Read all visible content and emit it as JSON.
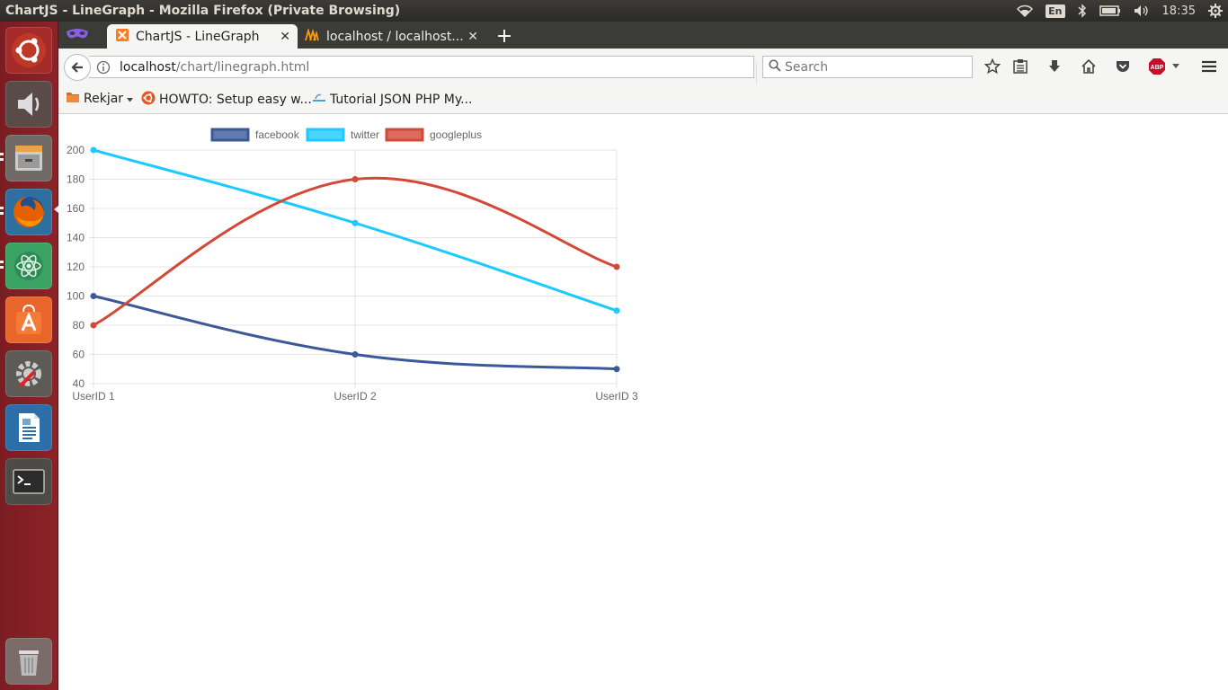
{
  "window": {
    "title": "ChartJS - LineGraph - Mozilla Firefox (Private Browsing)"
  },
  "panel": {
    "language": "En",
    "clock": "18:35"
  },
  "launcher": {
    "items": [
      "ubuntu-dash-icon",
      "sound-icon",
      "files-icon",
      "firefox-icon",
      "atom-icon",
      "software-center-icon",
      "system-settings-icon",
      "writer-icon",
      "terminal-icon",
      "trash-icon"
    ]
  },
  "tabs": [
    {
      "label": "ChartJS - LineGraph",
      "active": true
    },
    {
      "label": "localhost / localhost...",
      "active": false
    }
  ],
  "urlbar": {
    "host": "localhost",
    "path": "/chart/linegraph.html"
  },
  "search": {
    "placeholder": "Search"
  },
  "bookmarks": [
    {
      "label": "Rekjar"
    },
    {
      "label": "HOWTO: Setup easy w..."
    },
    {
      "label": "Tutorial JSON PHP My..."
    }
  ],
  "colors": {
    "facebook": "#3b5998",
    "twitter": "#1dcaff",
    "googleplus": "#d34836"
  },
  "chart_data": {
    "type": "line",
    "categories": [
      "UserID 1",
      "UserID 2",
      "UserID 3"
    ],
    "series": [
      {
        "name": "facebook",
        "values": [
          100,
          60,
          50
        ]
      },
      {
        "name": "twitter",
        "values": [
          200,
          150,
          90
        ]
      },
      {
        "name": "googleplus",
        "values": [
          80,
          180,
          120
        ]
      }
    ],
    "ylim": [
      40,
      200
    ],
    "yticks": [
      40,
      60,
      80,
      100,
      120,
      140,
      160,
      180,
      200
    ],
    "grid": true,
    "legend": "top"
  }
}
